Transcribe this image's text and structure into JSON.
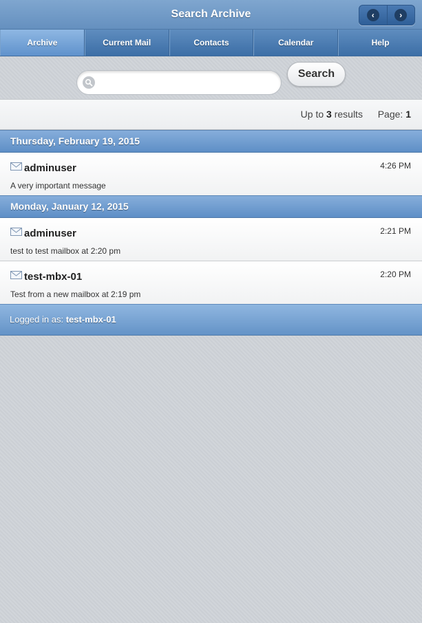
{
  "header": {
    "title": "Search Archive",
    "prev_icon": "chevron-left-icon",
    "next_icon": "chevron-right-icon"
  },
  "tabs": [
    {
      "label": "Archive",
      "active": true
    },
    {
      "label": "Current Mail",
      "active": false
    },
    {
      "label": "Contacts",
      "active": false
    },
    {
      "label": "Calendar",
      "active": false
    },
    {
      "label": "Help",
      "active": false
    }
  ],
  "search": {
    "value": "",
    "placeholder": "",
    "button_label": "Search",
    "icon": "search-icon"
  },
  "results": {
    "prefix": "Up to",
    "count": "3",
    "suffix": "results",
    "page_label": "Page:",
    "page": "1"
  },
  "groups": [
    {
      "date": "Thursday, February 19, 2015",
      "messages": [
        {
          "sender": "adminuser",
          "time": "4:26 PM",
          "preview": "A very important message"
        }
      ]
    },
    {
      "date": "Monday, January 12, 2015",
      "messages": [
        {
          "sender": "adminuser",
          "time": "2:21 PM",
          "preview": "test to test mailbox at 2:20 pm"
        },
        {
          "sender": "test-mbx-01",
          "time": "2:20 PM",
          "preview": "Test from a new mailbox at 2:19 pm"
        }
      ]
    }
  ],
  "footer": {
    "label": "Logged in as:",
    "user": "test-mbx-01"
  },
  "colors": {
    "header": "#6f9ac8",
    "tab_active": "#7aa8db",
    "divider": "#6e9cd0",
    "background": "#cfd3d8"
  }
}
